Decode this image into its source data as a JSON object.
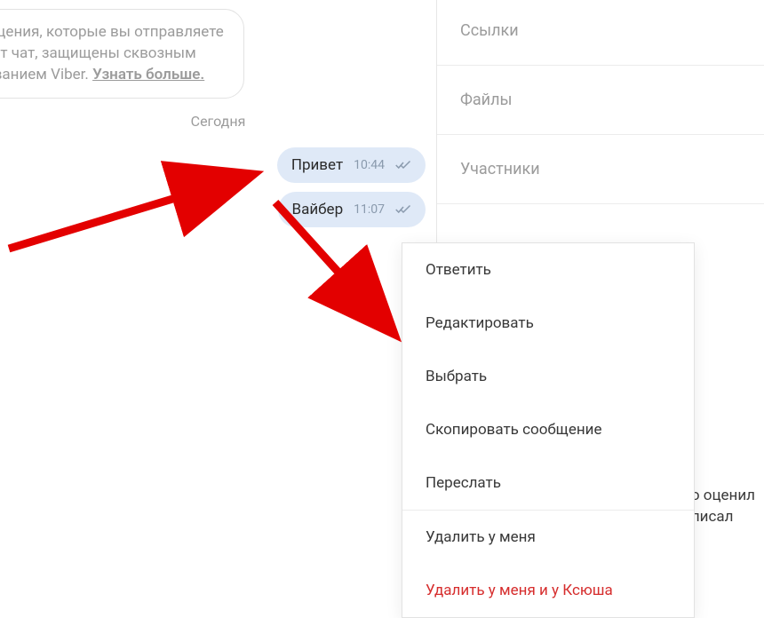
{
  "encryption": {
    "line1": "бщения, которые вы отправляете",
    "line2": "тот чат, защищены сквозным",
    "line3_pre": "ованием Viber. ",
    "learn_more": "Узнать больше."
  },
  "date_divider": "Сегодня",
  "messages": [
    {
      "text": "Привет",
      "time": "10:44"
    },
    {
      "text": "Вайбер",
      "time": "11:07"
    }
  ],
  "side_sections": {
    "links": "Ссылки",
    "files": "Файлы",
    "participants": "Участники"
  },
  "context_menu": {
    "reply": "Ответить",
    "edit": "Редактировать",
    "select": "Выбрать",
    "copy": "Скопировать сообщение",
    "forward": "Переслать",
    "delete_me": "Удалить у меня",
    "delete_all": "Удалить у меня и у Ксюша"
  },
  "side_extra": {
    "line1": "о оценил",
    "line2": "писал"
  }
}
